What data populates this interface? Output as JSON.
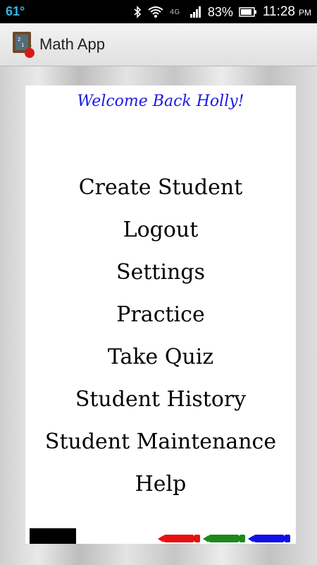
{
  "status_bar": {
    "temperature": "61°",
    "battery": "83%",
    "time": "11:28",
    "ampm": "PM"
  },
  "action_bar": {
    "title": "Math App"
  },
  "main": {
    "welcome": "Welcome Back Holly!",
    "menu": [
      "Create Student",
      "Logout",
      "Settings",
      "Practice",
      "Take Quiz",
      "Student History",
      "Student Maintenance",
      "Help"
    ]
  },
  "colors": {
    "status_bar_bg": "#000000",
    "temperature": "#33b5e5",
    "welcome_text": "#1a1ae6",
    "marker_red": "#e81010",
    "marker_green": "#1a8a1a",
    "marker_blue": "#1010e8"
  },
  "icons": [
    "bluetooth-icon",
    "wifi-icon",
    "network-4g-icon",
    "signal-icon",
    "battery-icon",
    "app-icon"
  ]
}
